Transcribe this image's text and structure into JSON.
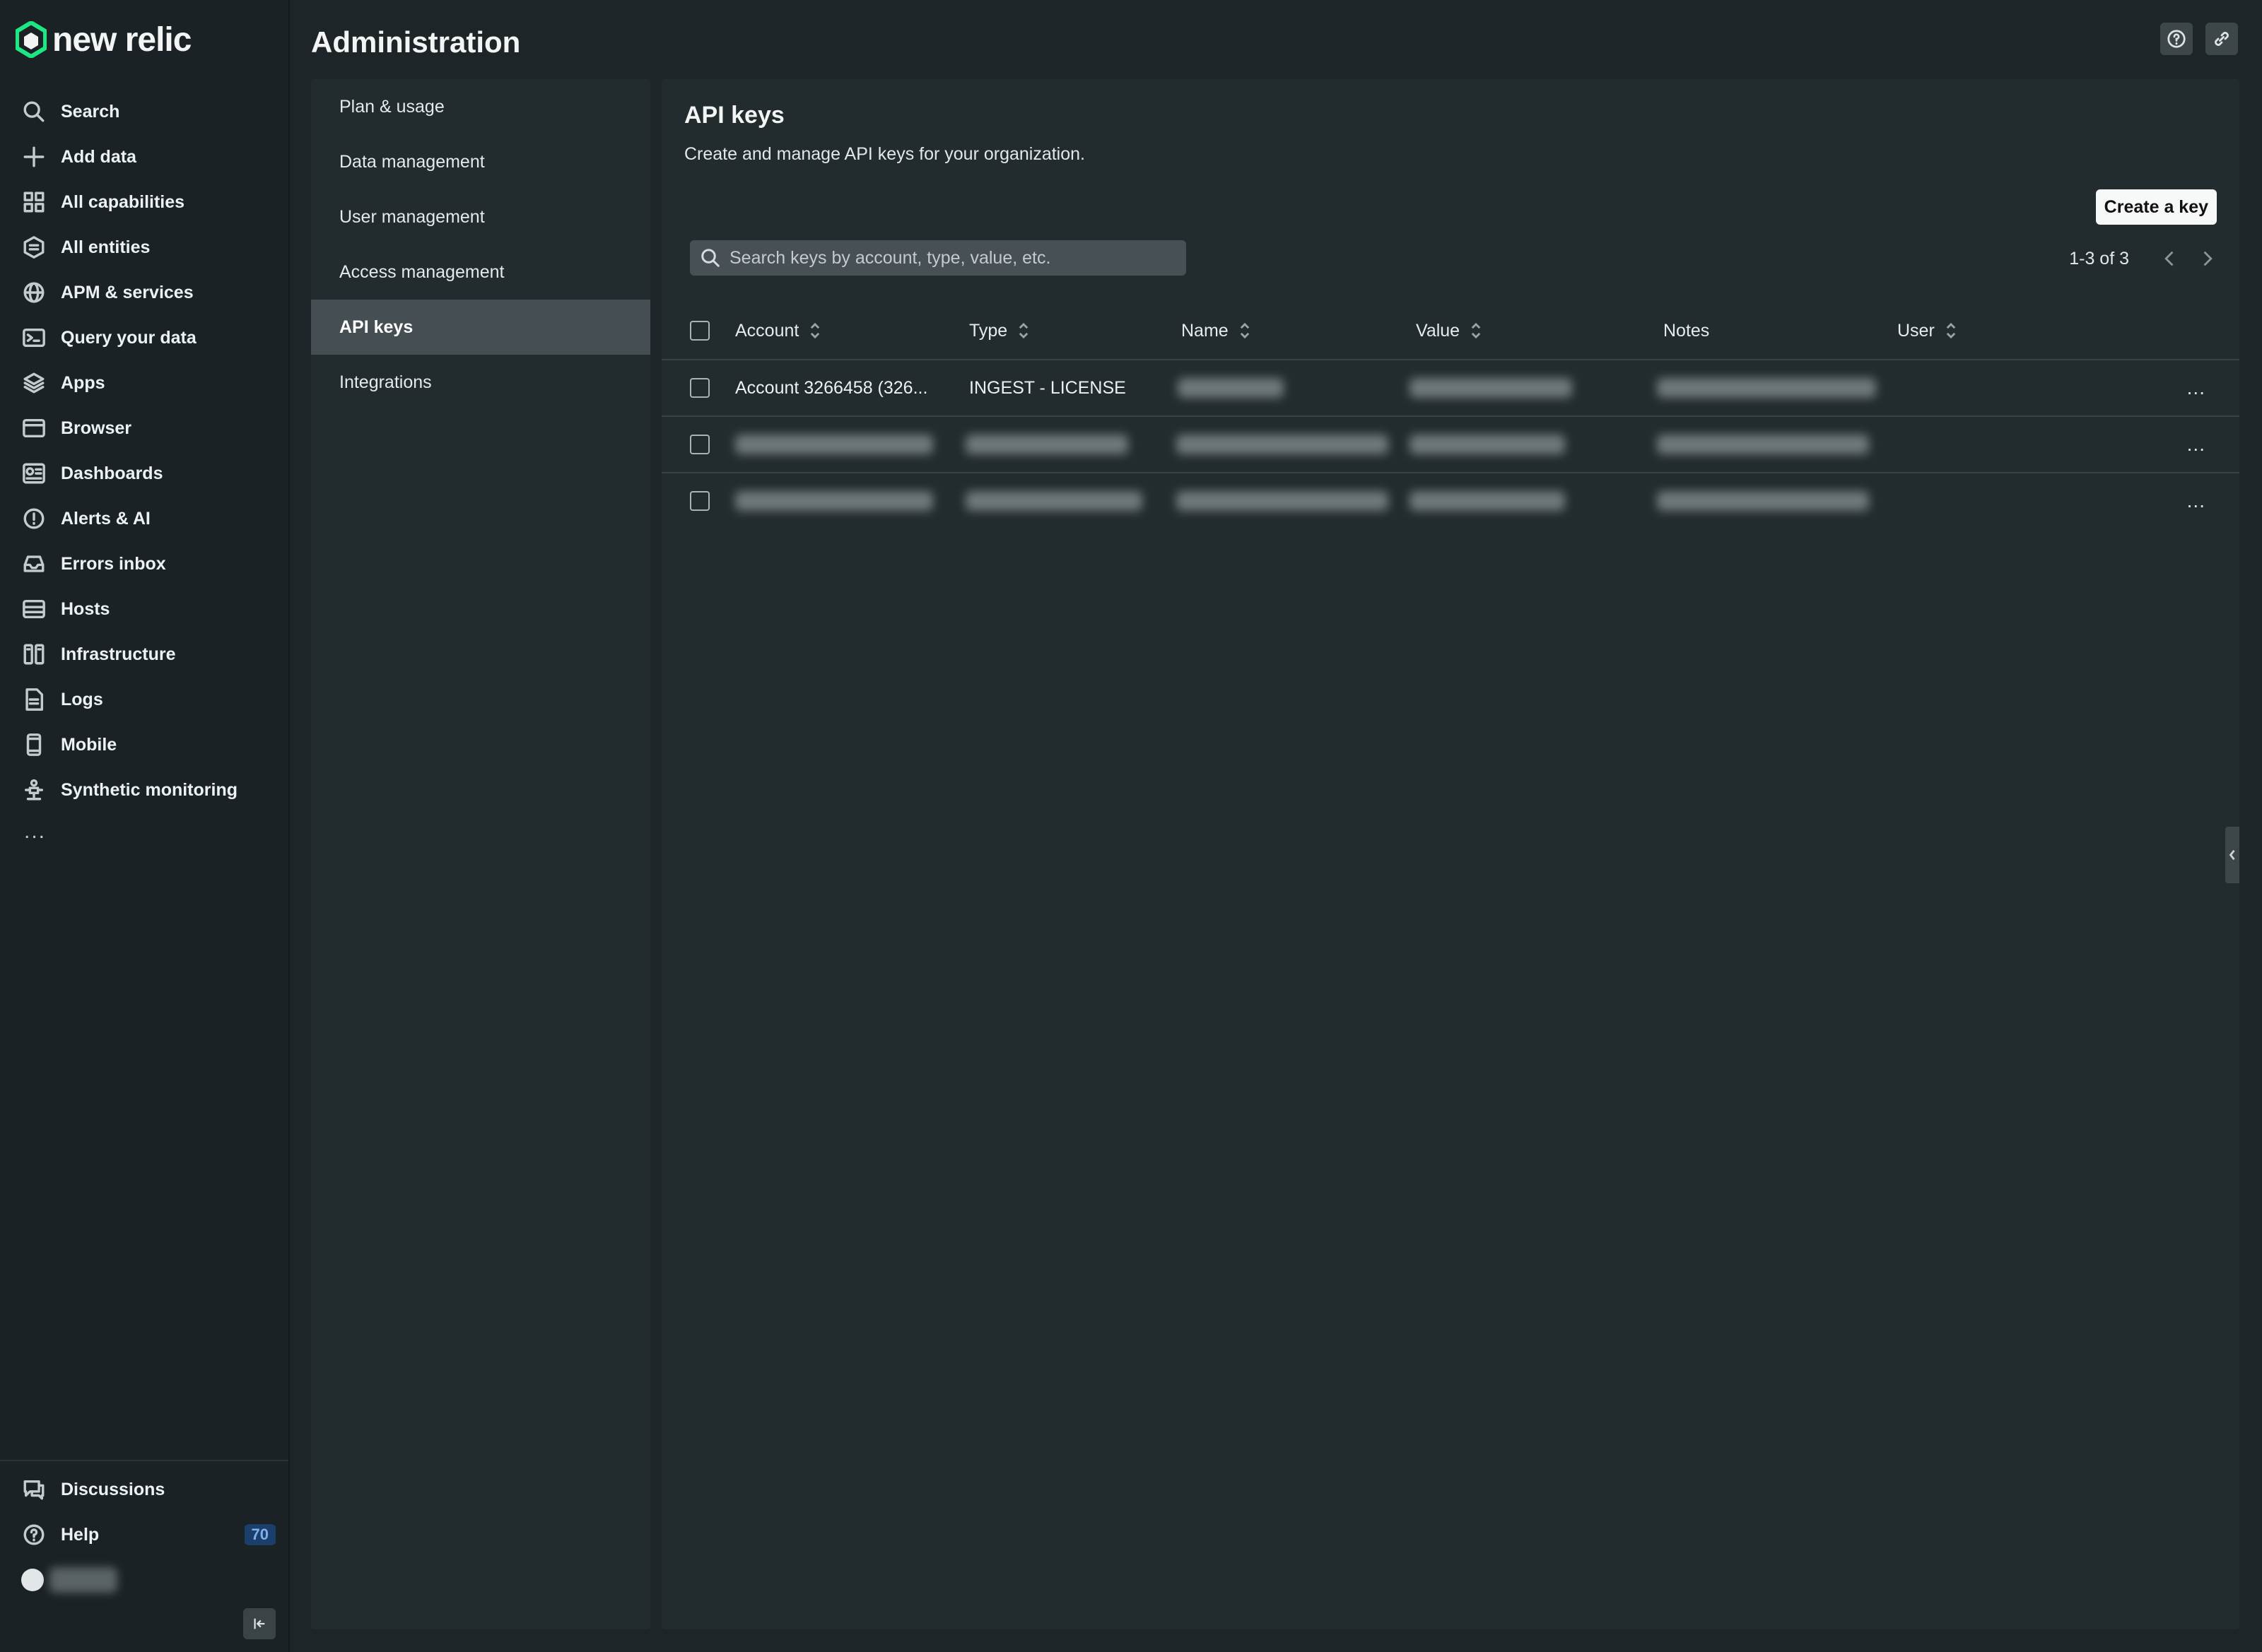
{
  "brand": {
    "name": "new relic",
    "accent": "#1ce783"
  },
  "nav": {
    "items": [
      {
        "label": "Search",
        "icon": "search-icon"
      },
      {
        "label": "Add data",
        "icon": "plus-icon"
      },
      {
        "label": "All capabilities",
        "icon": "grid-icon"
      },
      {
        "label": "All entities",
        "icon": "entities-icon"
      },
      {
        "label": "APM & services",
        "icon": "globe-icon"
      },
      {
        "label": "Query your data",
        "icon": "terminal-icon"
      },
      {
        "label": "Apps",
        "icon": "layers-icon"
      },
      {
        "label": "Browser",
        "icon": "browser-icon"
      },
      {
        "label": "Dashboards",
        "icon": "dashboard-icon"
      },
      {
        "label": "Alerts & AI",
        "icon": "alert-icon"
      },
      {
        "label": "Errors inbox",
        "icon": "inbox-icon"
      },
      {
        "label": "Hosts",
        "icon": "hosts-icon"
      },
      {
        "label": "Infrastructure",
        "icon": "infrastructure-icon"
      },
      {
        "label": "Logs",
        "icon": "logs-icon"
      },
      {
        "label": "Mobile",
        "icon": "mobile-icon"
      },
      {
        "label": "Synthetic monitoring",
        "icon": "synthetic-icon"
      }
    ],
    "more": "...",
    "bottom": {
      "discussions": "Discussions",
      "help": "Help",
      "help_badge": "70"
    }
  },
  "header": {
    "title": "Administration"
  },
  "submenu": {
    "items": [
      "Plan & usage",
      "Data management",
      "User management",
      "Access management",
      "API keys",
      "Integrations"
    ],
    "active": "API keys"
  },
  "panel": {
    "title": "API keys",
    "subtitle": "Create and manage API keys for your organization.",
    "create_button": "Create a key",
    "search_placeholder": "Search keys by account, type, value, etc.",
    "pager": "1-3 of 3",
    "columns": [
      "Account",
      "Type",
      "Name",
      "Value",
      "Notes",
      "User"
    ],
    "rows": [
      {
        "account": "Account 3266458 (326...",
        "type": "INGEST - LICENSE"
      }
    ],
    "row_menu": "..."
  }
}
